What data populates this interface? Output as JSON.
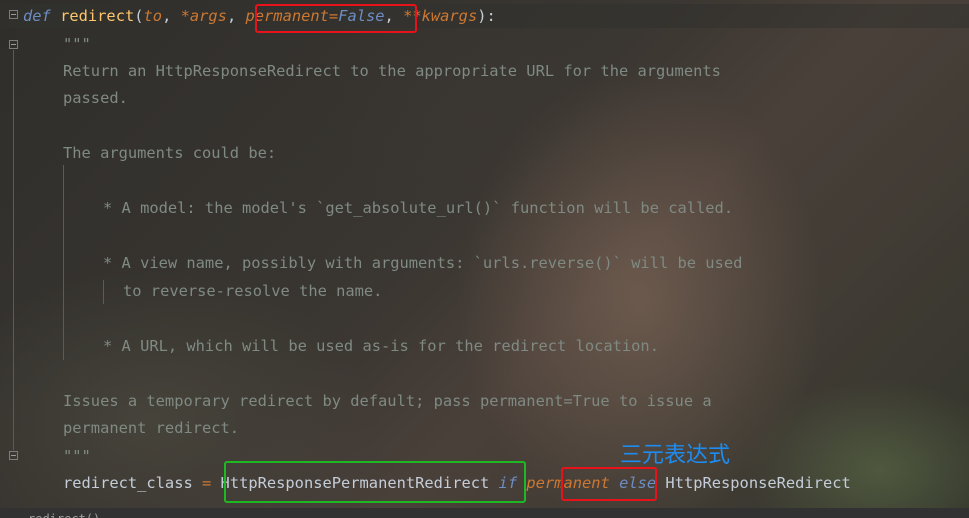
{
  "code": {
    "line1": {
      "def": "def",
      "name": "redirect",
      "open": "(",
      "to": "to",
      "comma1": ", ",
      "args": "*args",
      "comma2": ", ",
      "permanent": "permanent",
      "eq": "=",
      "false": "False",
      "comma3": ", ",
      "kwargs": "**kwargs",
      "close": "):"
    },
    "doc_open": "\"\"\"",
    "doc_lines": [
      "Return an HttpResponseRedirect to the appropriate URL for the arguments",
      "passed.",
      "The arguments could be:",
      "* A model: the model's `get_absolute_url()` function will be called.",
      "* A view name, possibly with arguments: `urls.reverse()` will be used",
      "to reverse-resolve the name.",
      "* A URL, which will be used as-is for the redirect location.",
      "Issues a temporary redirect by default; pass permanent=True to issue a",
      "permanent redirect."
    ],
    "doc_close": "\"\"\"",
    "last_line": {
      "var": "redirect_class",
      "assign": " = ",
      "true_class": "HttpResponsePermanentRedirect",
      "if": "if",
      "cond": "permanent",
      "else": "else",
      "false_class": "HttpResponseRedirect"
    }
  },
  "annotation": "三元表达式",
  "status_bar": "redirect()"
}
